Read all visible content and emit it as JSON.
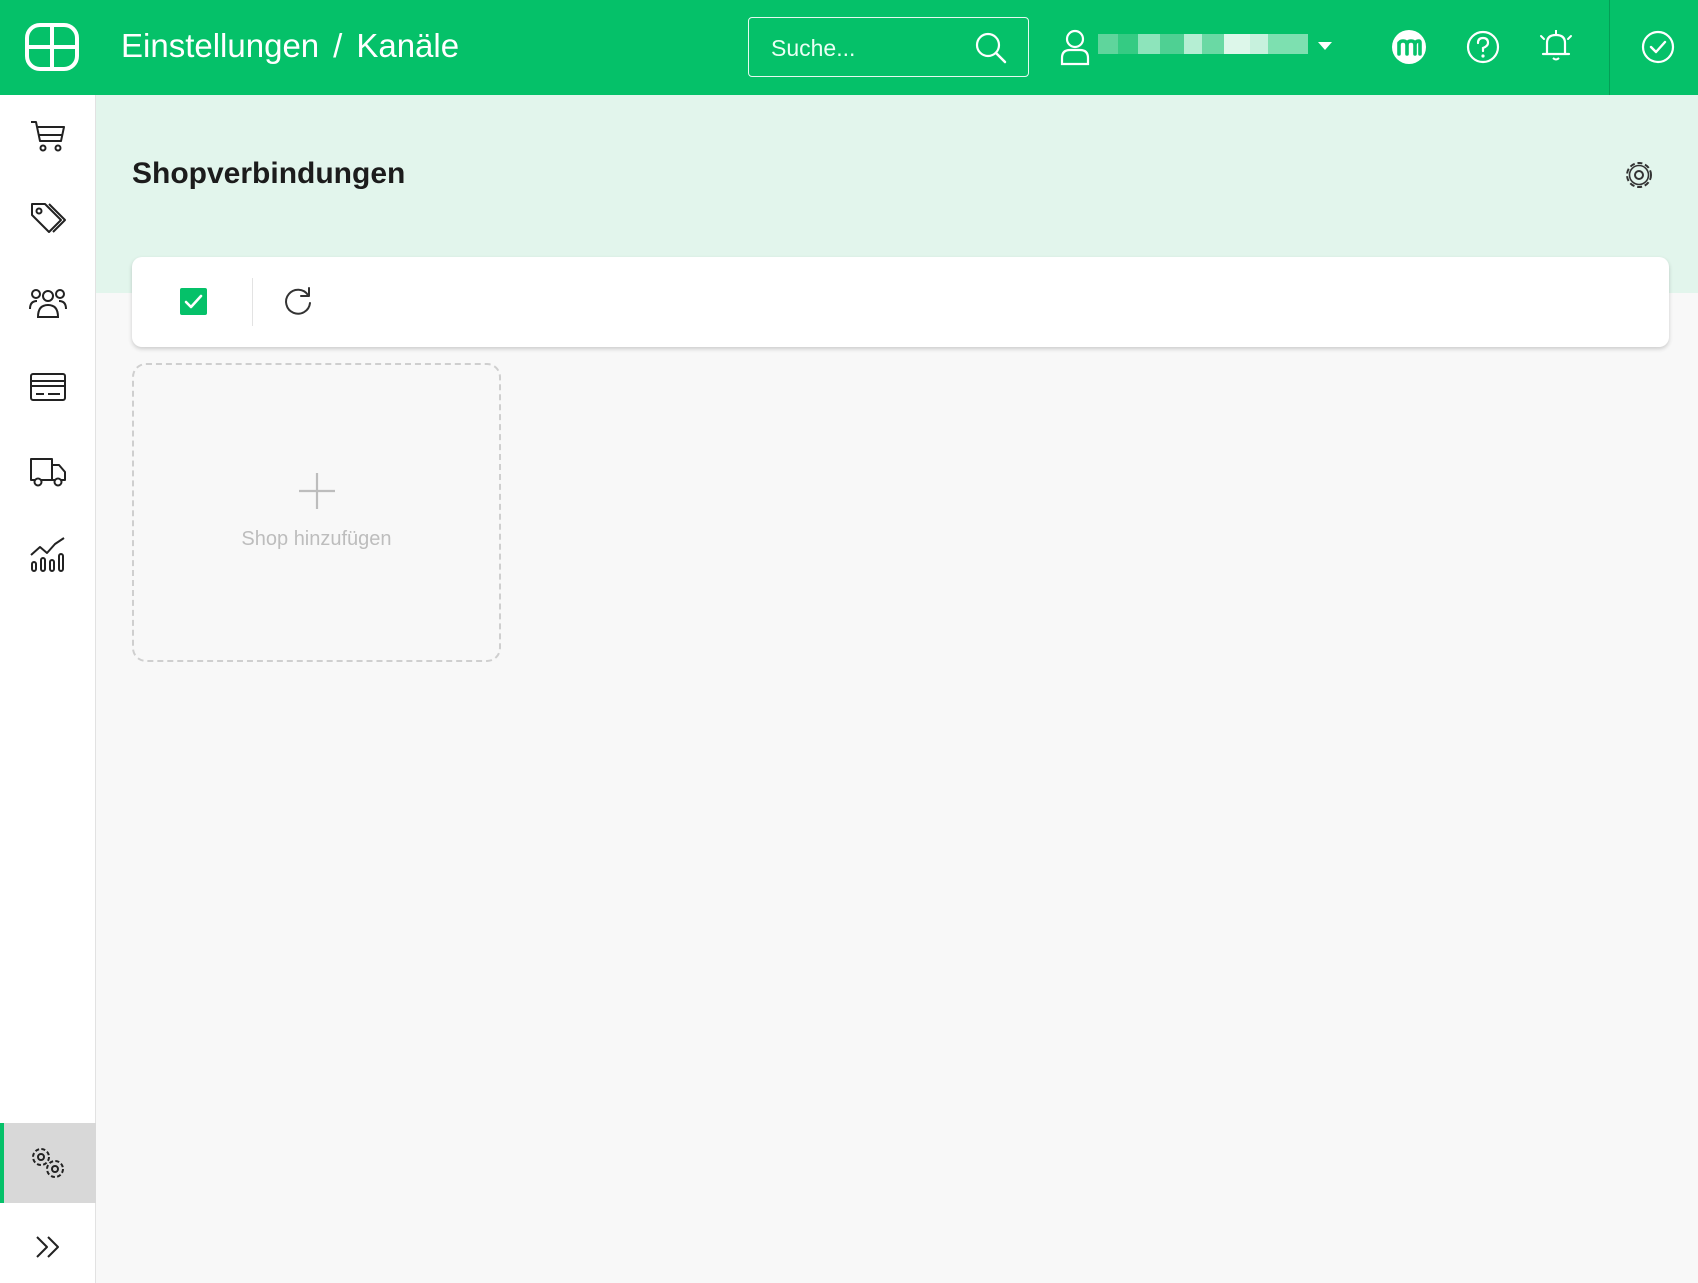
{
  "header": {
    "logo_icon": "brand-logo-icon",
    "breadcrumb": [
      "Einstellungen",
      "/",
      "Kanäle"
    ],
    "search": {
      "placeholder": "Suche...",
      "value": ""
    },
    "user": {
      "name": "",
      "icon": "user-icon",
      "menu_icon": "caret-down-icon"
    },
    "icons": [
      "marketplace-icon",
      "help-icon",
      "notification-bell-icon",
      "check-circle-icon"
    ],
    "accent_color": "#05c169"
  },
  "sidebar": {
    "items": [
      {
        "name": "orders",
        "icon": "shopping-cart-icon"
      },
      {
        "name": "products",
        "icon": "tags-icon"
      },
      {
        "name": "customers",
        "icon": "users-icon"
      },
      {
        "name": "payments",
        "icon": "credit-card-icon"
      },
      {
        "name": "shipping",
        "icon": "truck-icon"
      },
      {
        "name": "reports",
        "icon": "chart-icon"
      }
    ],
    "active": "settings",
    "settings_icon": "gears-icon",
    "expand_icon": "double-chevron-right-icon"
  },
  "main": {
    "title": "Shopverbindungen",
    "settings_icon": "gear-icon",
    "toolbar": {
      "select_all_checked": true,
      "refresh_icon": "refresh-icon"
    },
    "add_card": {
      "label": "Shop hinzufügen",
      "icon": "plus-icon"
    }
  }
}
